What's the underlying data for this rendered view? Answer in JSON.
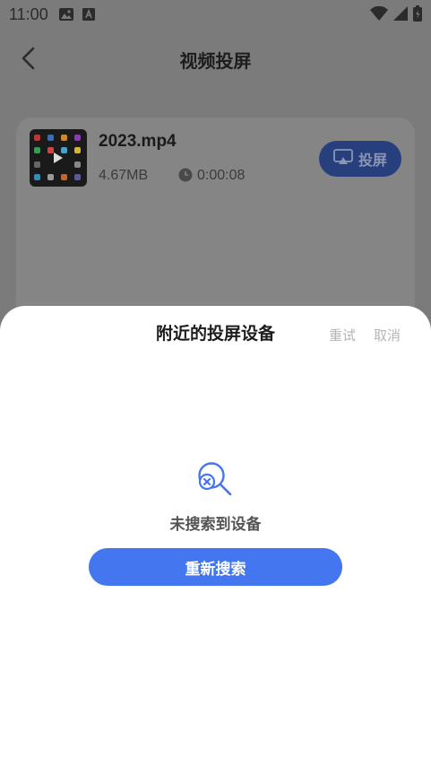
{
  "status_bar": {
    "time": "11:00",
    "icons": [
      "image-icon",
      "a-notification-icon",
      "wifi-icon",
      "signal-icon",
      "battery-icon"
    ]
  },
  "header": {
    "title": "视频投屏",
    "back_icon": "chevron-left-icon"
  },
  "video": {
    "name": "2023.mp4",
    "size": "4.67MB",
    "duration": "0:00:08",
    "cast_label": "投屏"
  },
  "sheet": {
    "title": "附近的投屏设备",
    "retry_label": "重试",
    "cancel_label": "取消",
    "empty_message": "未搜索到设备",
    "research_label": "重新搜索"
  },
  "colors": {
    "accent": "#4476EF",
    "overlay": "#7B7B7B",
    "muted_text": "#B5B5B5"
  }
}
